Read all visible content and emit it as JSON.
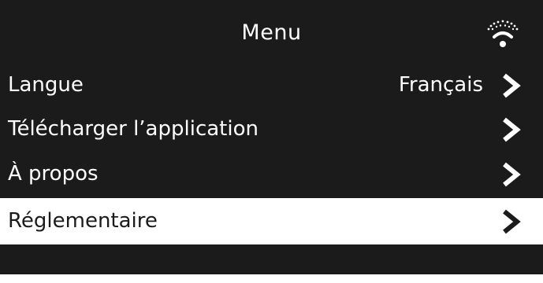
{
  "header": {
    "title": "Menu",
    "status_icon": "wifi-icon"
  },
  "menu": {
    "items": [
      {
        "label": "Langue",
        "value": "Français",
        "icon": "chevron-right-icon",
        "selected": false
      },
      {
        "label": "Télécharger l’application",
        "value": "",
        "icon": "chevron-right-icon",
        "selected": false
      },
      {
        "label": "À propos",
        "value": "",
        "icon": "chevron-right-icon",
        "selected": false
      },
      {
        "label": "Réglementaire",
        "value": "",
        "icon": "chevron-right-icon",
        "selected": true
      }
    ]
  },
  "colors": {
    "background": "#1c1b1b",
    "text": "#ffffff",
    "selected_background": "#ffffff",
    "selected_text": "#1c1b1b"
  }
}
